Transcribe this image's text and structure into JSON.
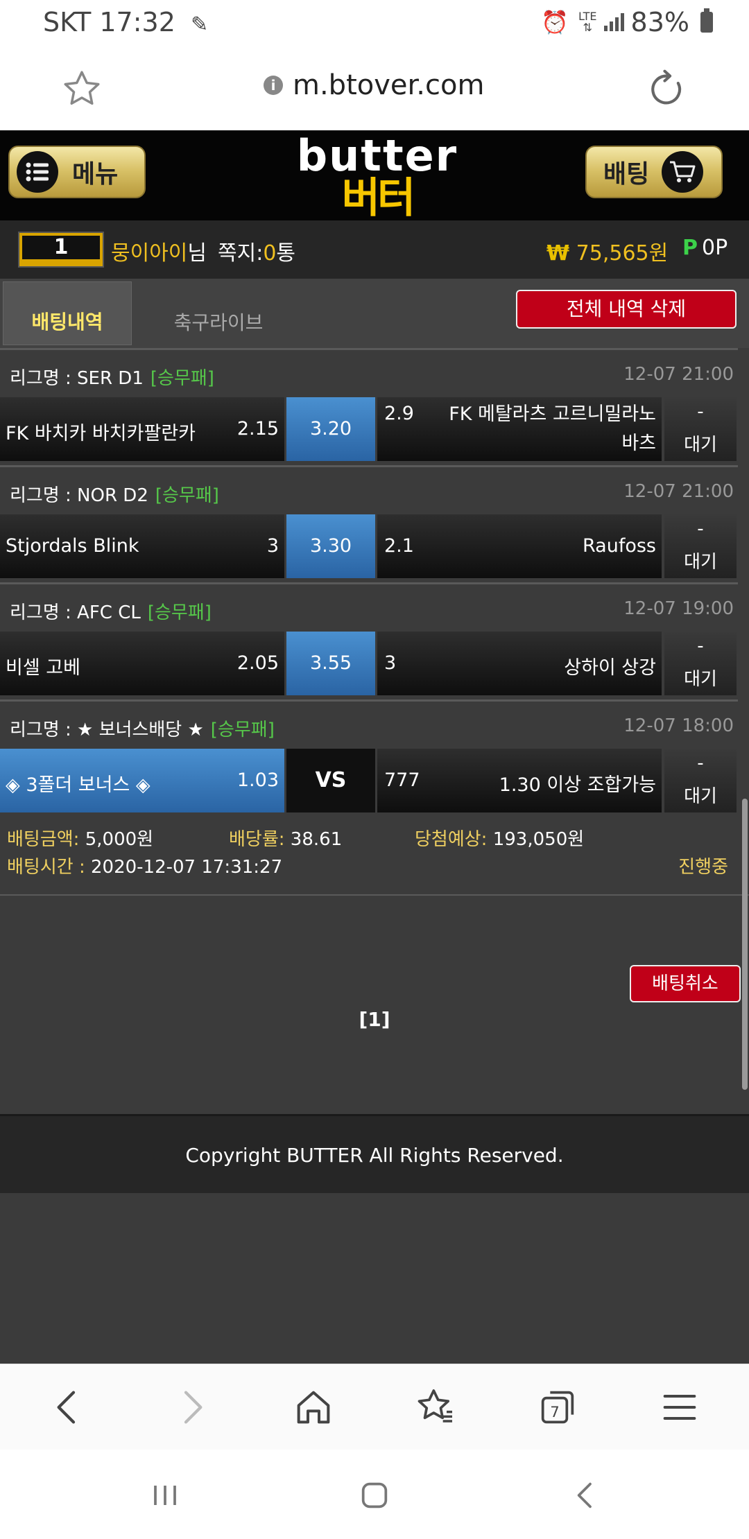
{
  "status_bar": {
    "carrier_time": "SKT 17:32",
    "network": "LTE",
    "battery": "83%"
  },
  "browser": {
    "url": "m.btover.com",
    "tab_count": "7"
  },
  "header": {
    "menu_label": "메뉴",
    "logo_en": "butter",
    "logo_ko": "버터",
    "bet_label": "배팅"
  },
  "user": {
    "level": "1",
    "name": "뭉이아이",
    "name_suffix": "님",
    "message_label": "쪽지:",
    "message_count": "0",
    "message_unit": "통",
    "money_symbol": "₩",
    "money": "75,565원",
    "point_symbol": "P",
    "points": "0P"
  },
  "tabs": [
    {
      "label": "배팅내역",
      "active": true
    },
    {
      "label": "축구라이브",
      "active": false
    }
  ],
  "delete_all_label": "전체 내역 삭제",
  "bets": [
    {
      "league_label": "리그명 : SER D1",
      "type": "[승무패]",
      "time": "12-07 21:00",
      "home": "FK 바치카 바치카팔란카",
      "home_odds": "2.15",
      "draw_odds": "3.20",
      "away_odds": "2.9",
      "away_line1": "FK 메탈라츠 고르니밀라노",
      "away_line2": "바츠",
      "status_dash": "-",
      "status": "대기"
    },
    {
      "league_label": "리그명 : NOR D2",
      "type": "[승무패]",
      "time": "12-07 21:00",
      "home": "Stjordals Blink",
      "home_odds": "3",
      "draw_odds": "3.30",
      "away_odds": "2.1",
      "away": "Raufoss",
      "status_dash": "-",
      "status": "대기"
    },
    {
      "league_label": "리그명 : AFC CL",
      "type": "[승무패]",
      "time": "12-07 19:00",
      "home": "비셀 고베",
      "home_odds": "2.05",
      "draw_odds": "3.55",
      "away_odds": "3",
      "away": "상하이 상강",
      "status_dash": "-",
      "status": "대기"
    },
    {
      "league_label": "리그명 : ★ 보너스배당 ★",
      "type": "[승무패]",
      "time": "12-07 18:00",
      "home": "◈ 3폴더 보너스 ◈",
      "home_odds": "1.03",
      "vs": "VS",
      "away_odds": "777",
      "away": "1.30 이상 조합가능",
      "status_dash": "-",
      "status": "대기"
    }
  ],
  "summary": {
    "amount_label": "배팅금액:",
    "amount": "5,000원",
    "rate_label": "배당률:",
    "rate": "38.61",
    "expected_label": "당첨예상:",
    "expected": "193,050원",
    "time_label": "배팅시간 :",
    "time": "2020-12-07 17:31:27",
    "state": "진행중"
  },
  "cancel_label": "배팅취소",
  "pagination": "[1]",
  "footer": "Copyright BUTTER All Rights Reserved.",
  "colors": {
    "accent_gold": "#f0c020",
    "league_tag": "#56c84a",
    "button_red": "#c00018",
    "odds_blue": "#2a64a4"
  }
}
